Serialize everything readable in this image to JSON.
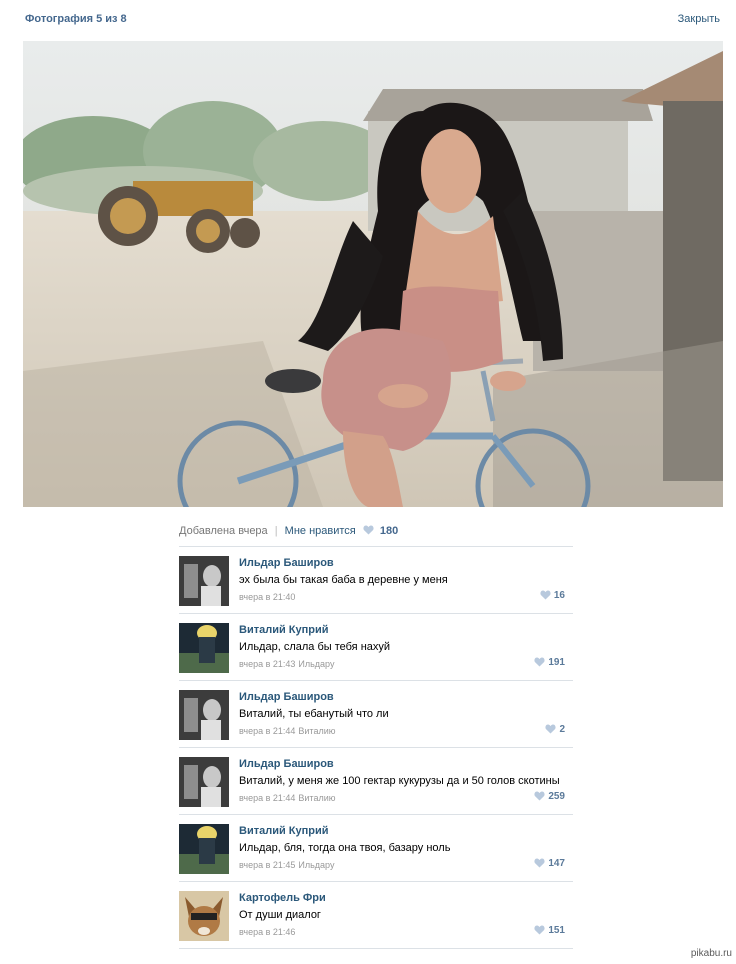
{
  "header": {
    "title": "Фотография 5 из 8",
    "close_label": "Закрыть"
  },
  "photo": {
    "alt": "фото"
  },
  "info": {
    "added": "Добавлена вчера",
    "separator": "|",
    "like_label": "Мне нравится",
    "likes": "180"
  },
  "comments": [
    {
      "author": "Ильдар Баширов",
      "text": "эх была бы такая баба в деревне у меня",
      "time": "вчера в 21:40",
      "reply_to": "",
      "likes": "16"
    },
    {
      "author": "Виталий Куприй",
      "text": "Ильдар, слала бы тебя нахуй",
      "time": "вчера в 21:43",
      "reply_to": "Ильдару",
      "likes": "191"
    },
    {
      "author": "Ильдар Баширов",
      "text": "Виталий, ты ебанутый что ли",
      "time": "вчера в 21:44",
      "reply_to": "Виталию",
      "likes": "2"
    },
    {
      "author": "Ильдар Баширов",
      "text": "Виталий, у меня же 100 гектар кукурузы да и 50 голов скотины",
      "time": "вчера в 21:44",
      "reply_to": "Виталию",
      "likes": "259"
    },
    {
      "author": "Виталий Куприй",
      "text": "Ильдар, бля, тогда она твоя, базару ноль",
      "time": "вчера в 21:45",
      "reply_to": "Ильдару",
      "likes": "147"
    },
    {
      "author": "Картофель Фри",
      "text": "От души диалог",
      "time": "вчера в 21:46",
      "reply_to": "",
      "likes": "151"
    }
  ],
  "watermark": "pikabu.ru",
  "colors": {
    "link": "#2b587a",
    "title": "#45688e",
    "heart": "#b8c9dd"
  }
}
